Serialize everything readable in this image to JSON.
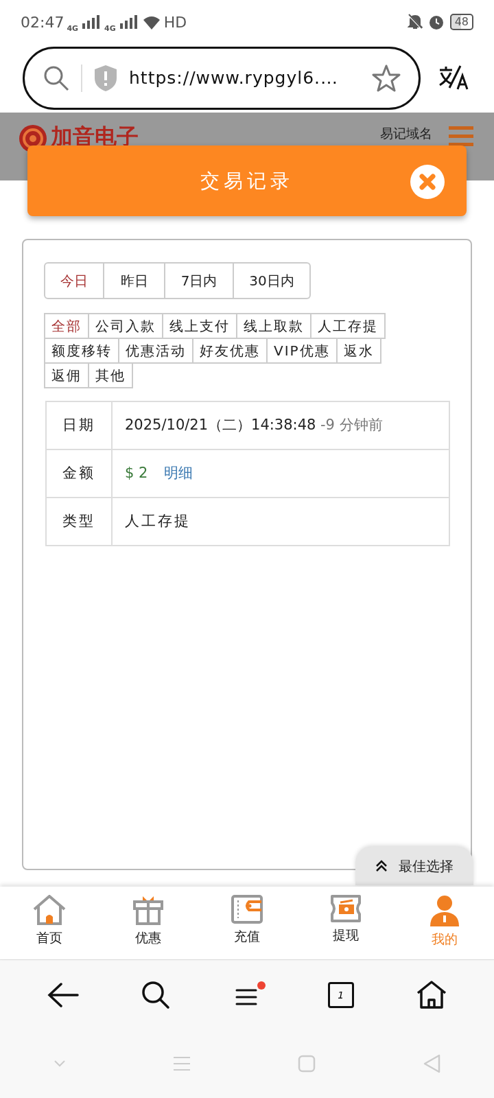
{
  "status_bar": {
    "time": "02:47",
    "network_1": "4G",
    "network_2": "4G",
    "hd": "HD",
    "battery": "48"
  },
  "browser": {
    "url": "https://www.rypgyl6.…"
  },
  "site_header": {
    "logo": "加音电子",
    "link": "易记域名"
  },
  "modal": {
    "title": "交易记录",
    "date_tabs": [
      {
        "label": "今日",
        "selected": true
      },
      {
        "label": "昨日",
        "selected": false
      },
      {
        "label": "7日内",
        "selected": false
      },
      {
        "label": "30日内",
        "selected": false
      }
    ],
    "type_filters": [
      {
        "label": "全部",
        "selected": true
      },
      {
        "label": "公司入款",
        "selected": false
      },
      {
        "label": "线上支付",
        "selected": false
      },
      {
        "label": "线上取款",
        "selected": false
      },
      {
        "label": "人工存提",
        "selected": false
      },
      {
        "label": "额度移转",
        "selected": false
      },
      {
        "label": "优惠活动",
        "selected": false
      },
      {
        "label": "好友优惠",
        "selected": false
      },
      {
        "label": "VIP优惠",
        "selected": false
      },
      {
        "label": "返水",
        "selected": false
      },
      {
        "label": "返佣",
        "selected": false
      },
      {
        "label": "其他",
        "selected": false
      }
    ],
    "record_rows": [
      {
        "kind": "date",
        "label": "日期",
        "value": "2025/10/21（二）14:38:48",
        "note": "-9 分钟前"
      },
      {
        "kind": "amount",
        "label": "金额",
        "value": "$ 2",
        "link": "明细"
      },
      {
        "kind": "text",
        "label": "类型",
        "value": "人工存提"
      }
    ]
  },
  "float_button": {
    "label": "最佳选择"
  },
  "bottom_nav": [
    {
      "kind": "home",
      "label": "首页",
      "selected": false
    },
    {
      "kind": "gift",
      "label": "优惠",
      "selected": false
    },
    {
      "kind": "wallet",
      "label": "充值",
      "selected": false
    },
    {
      "kind": "withdraw",
      "label": "提现",
      "selected": false
    },
    {
      "kind": "user",
      "label": "我的",
      "selected": true
    }
  ],
  "browser_toolbar": {
    "tab_count": "1",
    "menu_badge": true
  }
}
